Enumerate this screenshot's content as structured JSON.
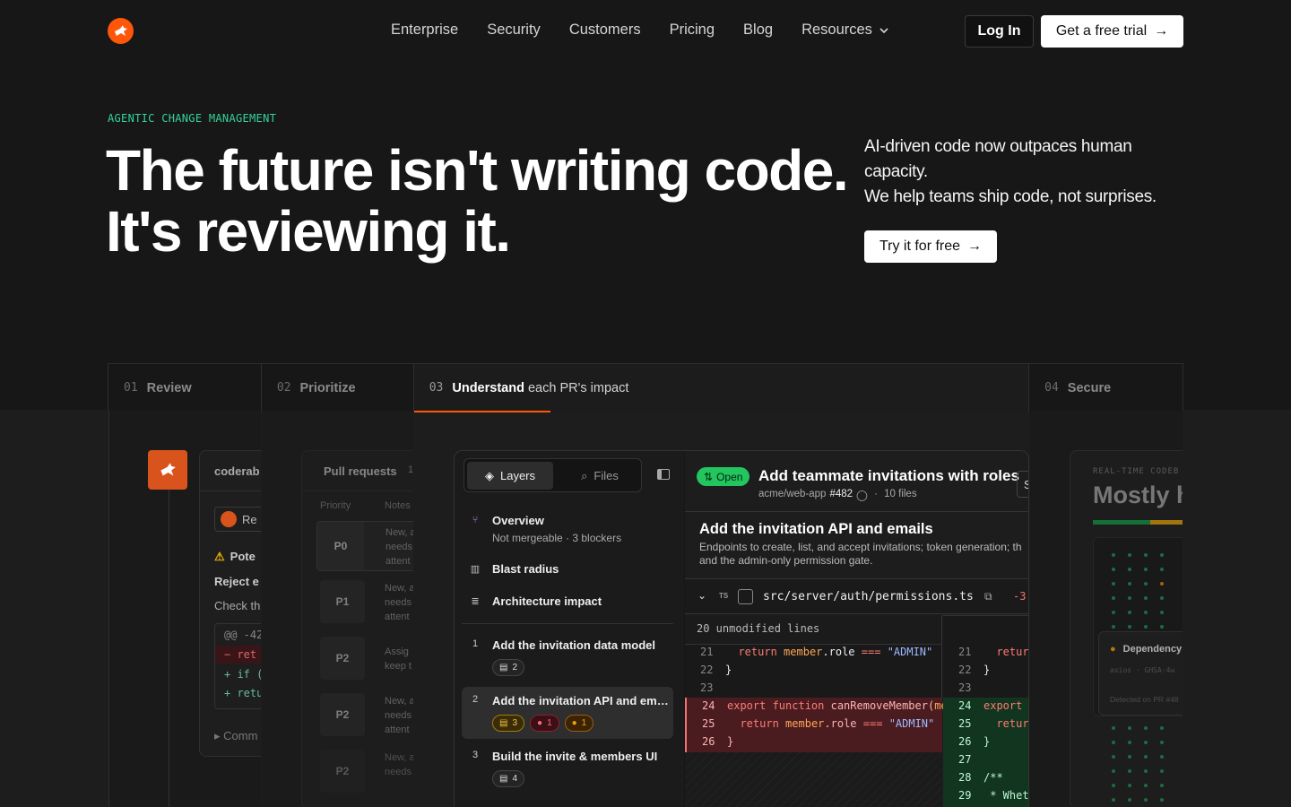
{
  "nav": {
    "links": [
      "Enterprise",
      "Security",
      "Customers",
      "Pricing",
      "Blog",
      "Resources"
    ],
    "login": "Log In",
    "trial": "Get a free trial"
  },
  "hero": {
    "eyebrow": "AGENTIC CHANGE MANAGEMENT",
    "line1": "The future isn't writing code.",
    "line2": "It's reviewing it.",
    "sub1": "AI-driven code now outpaces human capacity.",
    "sub2": "We help teams ship code, not surprises.",
    "cta": "Try it for free"
  },
  "tabs": [
    {
      "num": "01",
      "label": "Review",
      "extra": ""
    },
    {
      "num": "02",
      "label": "Prioritize",
      "extra": ""
    },
    {
      "num": "03",
      "label": "Understand",
      "extra": " each PR's impact"
    },
    {
      "num": "04",
      "label": "Secure",
      "extra": ""
    }
  ],
  "review": {
    "app": "coderab",
    "chip": "Re",
    "warn": "Pote",
    "reject": "Reject e",
    "check": "Check th",
    "hunk": "@@ -42",
    "minus": "− ret",
    "plus1": "+ if (",
    "plus2": "+ retu",
    "comm": "▸ Comm"
  },
  "prs": {
    "title": "Pull requests",
    "count": "1",
    "col1": "Priority",
    "col2": "Notes",
    "rows": [
      {
        "p": "P0",
        "n1": "New, a",
        "n2": "needs",
        "n3": "attent"
      },
      {
        "p": "P1",
        "n1": "New, a",
        "n2": "needs",
        "n3": "attent"
      },
      {
        "p": "P2",
        "n1": "Assig",
        "n2": "keep t",
        "n3": ""
      },
      {
        "p": "P2",
        "n1": "New, a",
        "n2": "needs",
        "n3": "attent"
      },
      {
        "p": "P2",
        "n1": "New, a",
        "n2": "needs",
        "n3": "attent"
      }
    ]
  },
  "app": {
    "seg_on": "Layers",
    "seg_off": "Files",
    "overview": "Overview",
    "overview_sub": "Not mergeable · 3 blockers",
    "blast": "Blast radius",
    "arch": "Architecture impact",
    "layers": [
      {
        "n": "1",
        "t": "Add the invitation data model",
        "c": "2"
      },
      {
        "n": "2",
        "t": "Add the invitation API and em…",
        "c1": "3",
        "c2": "1",
        "c3": "1"
      },
      {
        "n": "3",
        "t": "Build the invite & members UI",
        "c": "4"
      }
    ],
    "pr_status": "Open",
    "pr_title": "Add teammate invitations with roles",
    "repo": "acme/web-app",
    "prnum": "#482",
    "files": "10 files",
    "sec_title": "Add the invitation API and emails",
    "sec_desc1": "Endpoints to create, list, and accept invitations; token generation; th",
    "sec_desc2": "and the admin-only permission gate.",
    "file": "src/server/auth/permissions.ts",
    "delta": "-3",
    "unmod": "20 unmodified lines"
  },
  "secure": {
    "eyebrow": "REAL-TIME CODEB",
    "title": "Mostly h",
    "dep": "Dependency",
    "dep_sub": "axios · GHSA-4w",
    "det": "Detected on PR #48"
  }
}
